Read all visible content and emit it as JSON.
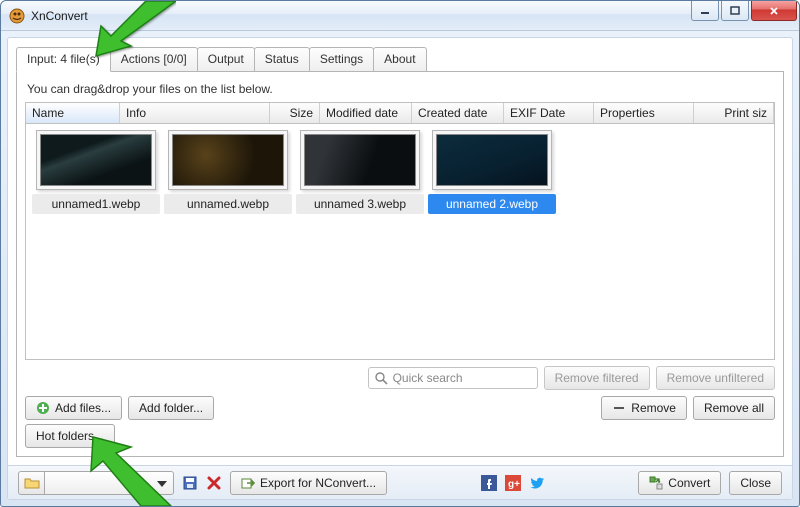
{
  "window": {
    "title": "XnConvert"
  },
  "tabs": {
    "input": "Input: 4 file(s)",
    "actions": "Actions [0/0]",
    "output": "Output",
    "status": "Status",
    "settings": "Settings",
    "about": "About"
  },
  "hint": "You can drag&drop your files on the list below.",
  "columns": {
    "name": "Name",
    "info": "Info",
    "size": "Size",
    "modified": "Modified date",
    "created": "Created date",
    "exif": "EXIF Date",
    "properties": "Properties",
    "printsize": "Print siz"
  },
  "files": [
    {
      "label": "unnamed1.webp",
      "selected": false,
      "pic": "pic1"
    },
    {
      "label": "unnamed.webp",
      "selected": false,
      "pic": "pic2"
    },
    {
      "label": "unnamed 3.webp",
      "selected": false,
      "pic": "pic3"
    },
    {
      "label": "unnamed 2.webp",
      "selected": true,
      "pic": "pic4"
    }
  ],
  "search": {
    "placeholder": "Quick search"
  },
  "buttons": {
    "remove_filtered": "Remove filtered",
    "remove_unfiltered": "Remove unfiltered",
    "add_files": "Add files...",
    "add_folder": "Add folder...",
    "remove": "Remove",
    "remove_all": "Remove all",
    "hot_folders": "Hot folders...",
    "export": "Export for NConvert...",
    "convert": "Convert",
    "close": "Close"
  },
  "colors": {
    "accent": "#2d89ef",
    "arrow": "#3fbf2f"
  }
}
